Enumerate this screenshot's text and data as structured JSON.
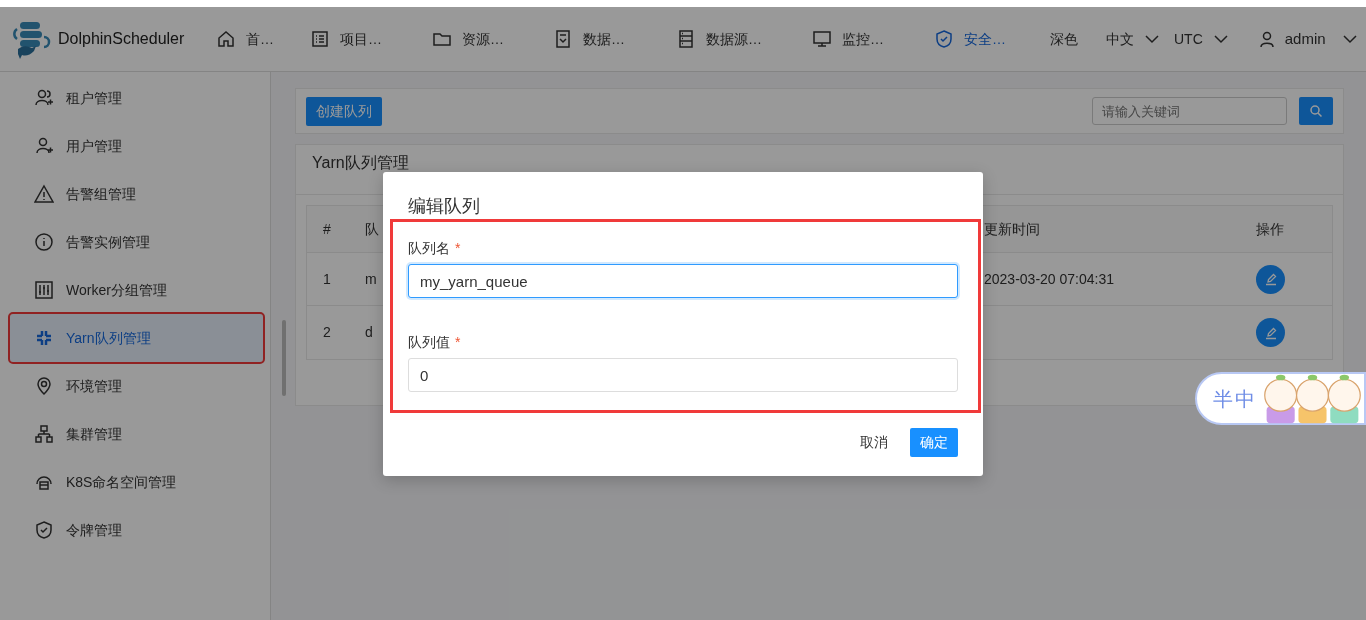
{
  "header": {
    "brand": "DolphinScheduler",
    "nav": [
      {
        "label": "首…",
        "selected": false
      },
      {
        "label": "项目…",
        "selected": false
      },
      {
        "label": "资源…",
        "selected": false
      },
      {
        "label": "数据…",
        "selected": false
      },
      {
        "label": "数据源…",
        "selected": false
      },
      {
        "label": "监控…",
        "selected": false
      },
      {
        "label": "安全…",
        "selected": true
      }
    ],
    "theme": "深色",
    "language": "中文",
    "timezone": "UTC",
    "user": "admin"
  },
  "sidebar": {
    "items": [
      {
        "label": "租户管理",
        "selected": false,
        "highlighted": false
      },
      {
        "label": "用户管理",
        "selected": false,
        "highlighted": false
      },
      {
        "label": "告警组管理",
        "selected": false,
        "highlighted": false
      },
      {
        "label": "告警实例管理",
        "selected": false,
        "highlighted": false
      },
      {
        "label": "Worker分组管理",
        "selected": false,
        "highlighted": false
      },
      {
        "label": "Yarn队列管理",
        "selected": true,
        "highlighted": true
      },
      {
        "label": "环境管理",
        "selected": false,
        "highlighted": false
      },
      {
        "label": "集群管理",
        "selected": false,
        "highlighted": false
      },
      {
        "label": "K8S命名空间管理",
        "selected": false,
        "highlighted": false
      },
      {
        "label": "令牌管理",
        "selected": false,
        "highlighted": false
      }
    ]
  },
  "toolbar": {
    "create_button": "创建队列",
    "search": {
      "placeholder": "请输入关键词"
    }
  },
  "panel": {
    "title": "Yarn队列管理",
    "table": {
      "columns": [
        "#",
        "队",
        "更新时间",
        "操作"
      ],
      "rows": [
        {
          "cells": [
            "1",
            "m",
            "2023-03-20 07:04:31"
          ]
        },
        {
          "cells": [
            "2",
            "d"
          ]
        }
      ]
    }
  },
  "modal": {
    "title": "编辑队列",
    "highlighted": true,
    "fields": [
      {
        "label": "队列名",
        "required": true,
        "required_mark": "*",
        "value": "my_yarn_queue",
        "focused": true
      },
      {
        "label": "队列值",
        "required": true,
        "required_mark": "*",
        "value": "0",
        "focused": false
      }
    ],
    "buttons": [
      {
        "label": "取消",
        "kind": "text"
      },
      {
        "label": "确定",
        "kind": "primary"
      }
    ]
  },
  "ime": {
    "keys": [
      "半",
      "中"
    ]
  }
}
